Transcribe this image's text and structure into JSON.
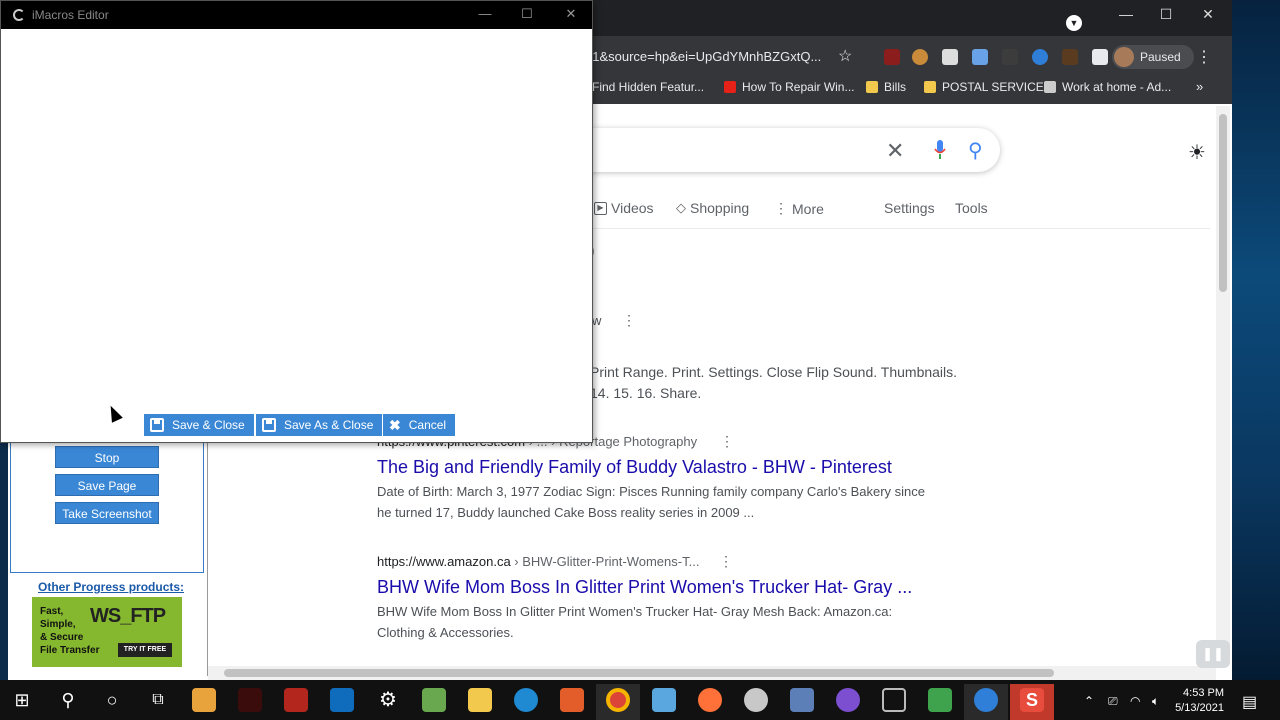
{
  "editor": {
    "title": "iMacros Editor",
    "buttons": {
      "save_close": "Save & Close",
      "save_as_close": "Save As & Close",
      "cancel": "Cancel"
    }
  },
  "chrome": {
    "address_visible": "21&source=hp&ei=UpGdYMnhBZGxtQ...",
    "profile_status": "Paused",
    "bookmarks": [
      {
        "label": "Find Hidden Featur..."
      },
      {
        "label": "How To Repair Win..."
      },
      {
        "label": "Bills"
      },
      {
        "label": "POSTAL SERVICE"
      },
      {
        "label": "Work at home - Ad..."
      }
    ]
  },
  "google": {
    "tabs": {
      "videos": "Videos",
      "shopping": "Shopping",
      "more": "More",
      "settings": "Settings",
      "tools": "Tools"
    },
    "fragments": {
      "paren": ")",
      "w": "w",
      "snippet_line1": "Print Range. Print. Settings. Close Flip Sound. Thumbnails.",
      "snippet_line2": "14. 15. 16. Share.",
      "partial_url": "https://www.pinterest.com › ... › Reportage Photography"
    },
    "results": [
      {
        "url": "https://www.pinterest.com",
        "crumb": " › ... › Reportage Photography",
        "title": "The Big and Friendly Family of Buddy Valastro - BHW - Pinterest",
        "snippet": "Date of Birth: March 3, 1977 Zodiac Sign: Pisces Running family company Carlo's Bakery since he turned 17, Buddy launched Cake Boss reality series in 2009 ..."
      },
      {
        "url": "https://www.amazon.ca",
        "crumb": " › BHW-Glitter-Print-Womens-T...",
        "title": "BHW Wife Mom Boss In Glitter Print Women's Trucker Hat- Gray ...",
        "snippet": "BHW Wife Mom Boss In Glitter Print Women's Trucker Hat- Gray Mesh Back: Amazon.ca: Clothing & Accessories."
      }
    ]
  },
  "imacros_panel": {
    "buttons": {
      "stop": "Stop",
      "save_page": "Save Page",
      "take_screenshot": "Take Screenshot"
    },
    "other_products": "Other Progress products:",
    "ad": {
      "text": "Fast,\nSimple,\n& Secure\nFile Transfer",
      "logo": "WS_FTP",
      "cta": "TRY IT FREE"
    }
  },
  "taskbar": {
    "time": "4:53 PM",
    "date": "5/13/2021"
  }
}
